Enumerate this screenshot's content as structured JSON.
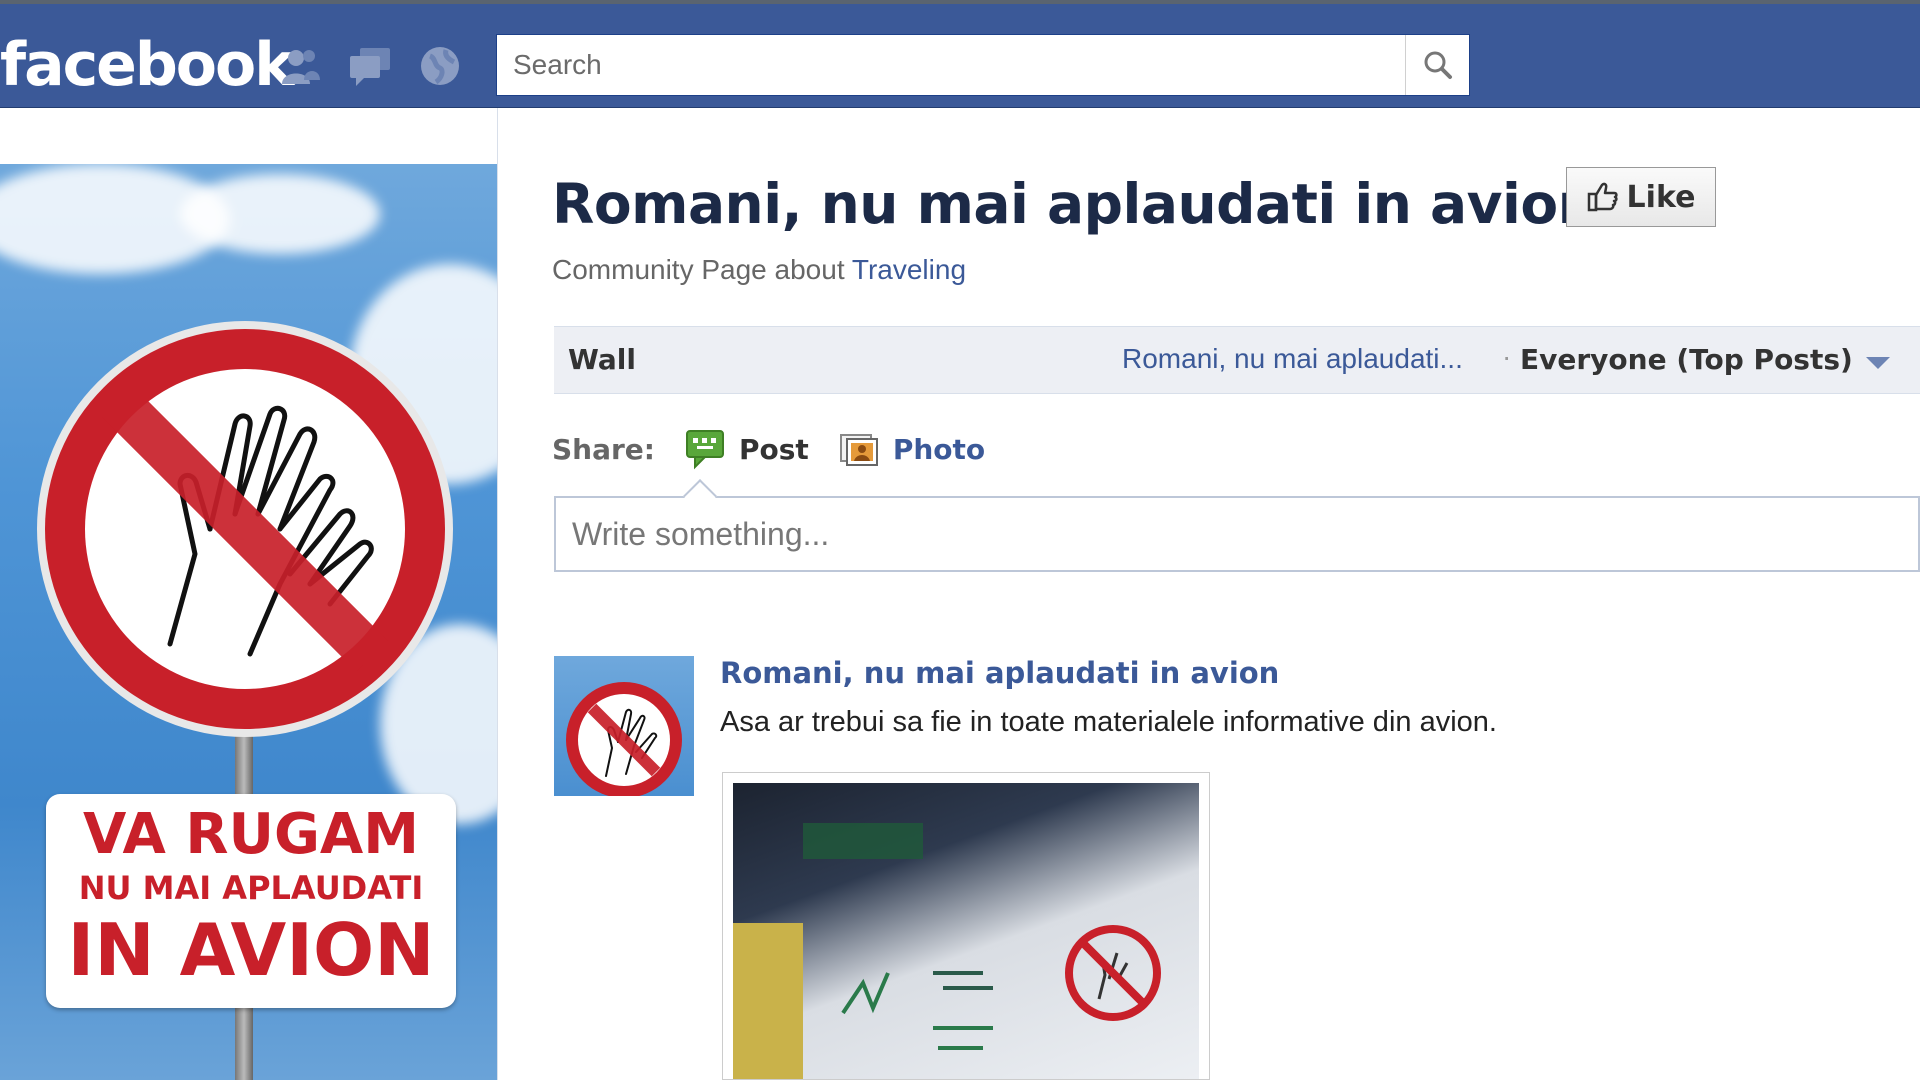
{
  "topbar": {
    "logo": "facebook",
    "jewels": [
      "friend-requests-icon",
      "messages-icon",
      "notifications-icon"
    ],
    "search": {
      "placeholder": "Search",
      "value": ""
    }
  },
  "left": {
    "profile_image": {
      "line1": "VA RUGAM",
      "line2": "NU MAI APLAUDATI",
      "line3": "IN AVION"
    }
  },
  "page": {
    "title": "Romani, nu mai aplaudati in avion",
    "like_label": "Like",
    "subtitle_prefix": "Community Page about",
    "subtitle_link": "Traveling"
  },
  "wall": {
    "tab": "Wall",
    "filter_page": "Romani, nu mai aplaudati...",
    "filter_selected": "Everyone (Top Posts)"
  },
  "share": {
    "label": "Share:",
    "post_label": "Post",
    "photo_label": "Photo",
    "composer_placeholder": "Write something..."
  },
  "story": {
    "author": "Romani, nu mai aplaudati in avion",
    "message": "Asa ar trebui sa fie in toate materialele informative din avion."
  },
  "colors": {
    "brand_blue": "#3b5998",
    "sign_red": "#c8202a",
    "wall_bar_bg": "#edeff4"
  }
}
